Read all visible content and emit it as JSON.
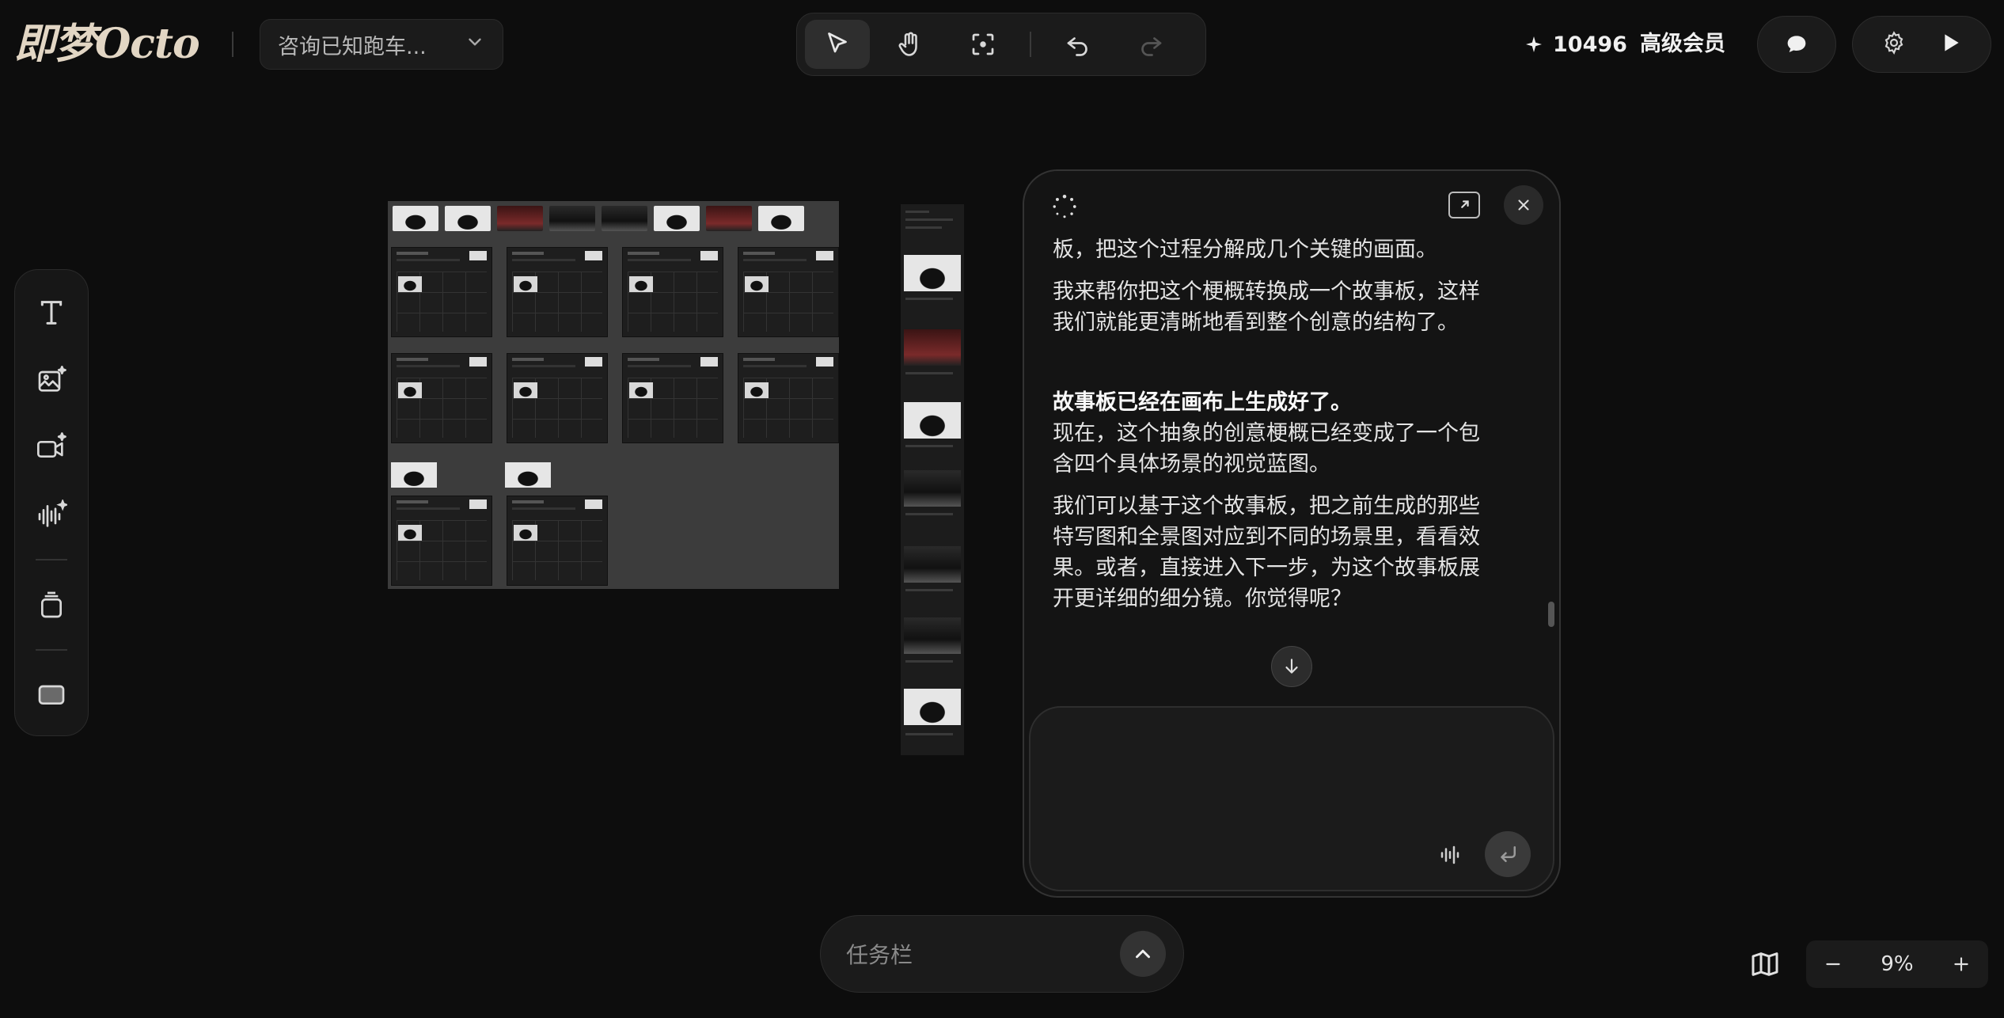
{
  "app": {
    "logo_text": "即梦Octo",
    "project_title": "咨询已知跑车..."
  },
  "header": {
    "credits": "10496",
    "membership": "高级会员"
  },
  "toolbar": {
    "tools": [
      "select-cursor",
      "hand-pan",
      "focus-frame",
      "undo",
      "redo"
    ],
    "active_tool": "select-cursor"
  },
  "left_rail": {
    "tools": [
      "text",
      "image-generate",
      "video-generate",
      "audio-generate",
      "layers",
      "frame"
    ]
  },
  "chat": {
    "paragraphs": [
      "板，把这个过程分解成几个关键的画面。",
      "我来帮你把这个梗概转换成一个故事板，这样我们就能更清晰地看到整个创意的结构了。",
      "故事板已经在画布上生成好了。",
      "现在，这个抽象的创意梗概已经变成了一个包含四个具体场景的视觉蓝图。",
      "我们可以基于这个故事板，把之前生成的那些特写图和全景图对应到不同的场景里，看看效果。或者，直接进入下一步，为这个故事板展开更详细的细分镜。你觉得呢？"
    ],
    "input_placeholder": ""
  },
  "taskbar": {
    "label": "任务栏"
  },
  "zoom": {
    "level": "9%"
  },
  "colors": {
    "background": "#0d0d0d",
    "panel": "#1b1b1b",
    "board": "#3c3c3c",
    "logo": "#e2d6c4"
  }
}
